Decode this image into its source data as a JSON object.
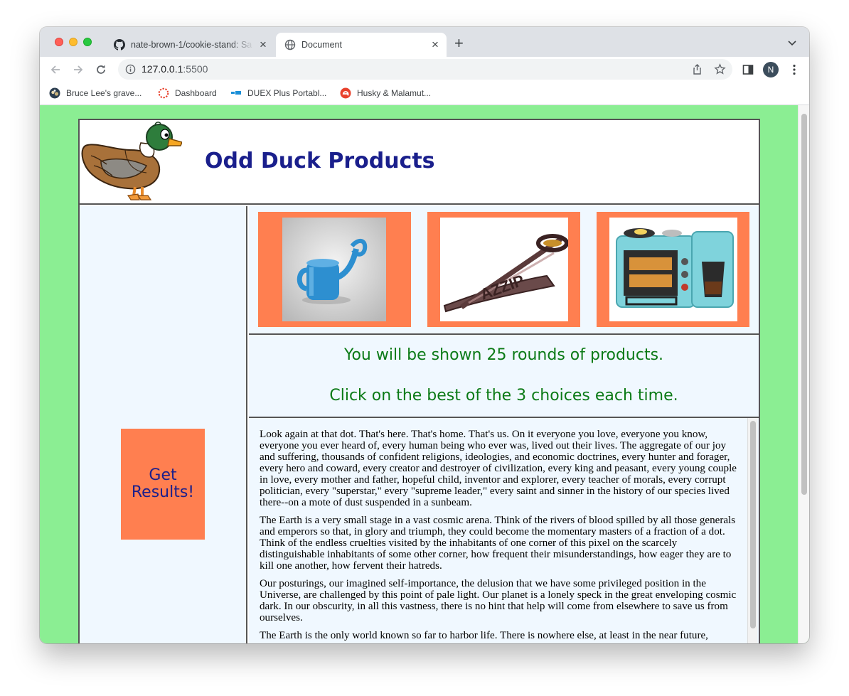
{
  "browser": {
    "tabs": [
      {
        "title": "nate-brown-1/cookie-stand: Sa",
        "icon": "github-icon",
        "active": false
      },
      {
        "title": "Document",
        "icon": "globe-icon",
        "active": true
      }
    ],
    "new_tab_label": "+",
    "close_label": "×",
    "url_host": "127.0.0.1",
    "url_port": ":5500",
    "profile_initial": "N",
    "bookmarks": [
      {
        "label": "Bruce Lee's grave...",
        "icon": "dog-favicon-icon"
      },
      {
        "label": "Dashboard",
        "icon": "dashboard-ring-icon"
      },
      {
        "label": "DUEX Plus Portabl...",
        "icon": "duex-favicon-icon"
      },
      {
        "label": "Husky & Malamut...",
        "icon": "e-favicon-icon"
      }
    ]
  },
  "page": {
    "title": "Odd Duck Products",
    "results_button": "Get Results!",
    "instructions": [
      "You will be shown 25 rounds of products.",
      "Click on the best of the 3 choices each time."
    ],
    "products": [
      {
        "icon": "watering-can-image"
      },
      {
        "icon": "pizza-scissors-image"
      },
      {
        "icon": "breakfast-station-image"
      }
    ],
    "paragraphs": [
      "Look again at that dot. That's here. That's home. That's us. On it everyone you love, everyone you know, everyone you ever heard of, every human being who ever was, lived out their lives. The aggregate of our joy and suffering, thousands of confident religions, ideologies, and economic doctrines, every hunter and forager, every hero and coward, every creator and destroyer of civilization, every king and peasant, every young couple in love, every mother and father, hopeful child, inventor and explorer, every teacher of morals, every corrupt politician, every \"superstar,\" every \"supreme leader,\" every saint and sinner in the history of our species lived there--on a mote of dust suspended in a sunbeam.",
      "The Earth is a very small stage in a vast cosmic arena. Think of the rivers of blood spilled by all those generals and emperors so that, in glory and triumph, they could become the momentary masters of a fraction of a dot. Think of the endless cruelties visited by the inhabitants of one corner of this pixel on the scarcely distinguishable inhabitants of some other corner, how frequent their misunderstandings, how eager they are to kill one another, how fervent their hatreds.",
      "Our posturings, our imagined self-importance, the delusion that we have some privileged position in the Universe, are challenged by this point of pale light. Our planet is a lonely speck in the great enveloping cosmic dark. In our obscurity, in all this vastness, there is no hint that help will come from elsewhere to save us from ourselves.",
      "The Earth is the only world known so far to harbor life. There is nowhere else, at least in the near future,"
    ],
    "colors": {
      "background": "#8bee93",
      "panel": "#f0f8ff",
      "accent": "#ff7f50",
      "title": "#1a1f8c",
      "instructions": "#0b7a16"
    }
  }
}
